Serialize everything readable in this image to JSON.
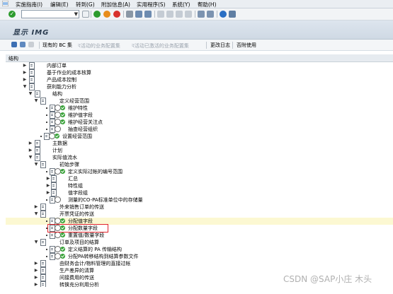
{
  "menu": {
    "items": [
      "实施指南(I)",
      "编辑(E)",
      "转到(G)",
      "附加信息(A)",
      "实用程序(S)",
      "系统(Y)",
      "帮助(H)"
    ]
  },
  "page": {
    "title": "显示 IMG"
  },
  "app_toolbar": {
    "bc_sets_label": "现有的 BC 集",
    "active_bc_label": "ব活动的业务配置集",
    "active_bc_label2": "ব活动已激活的业务配置集",
    "change_log_label": "更改日志",
    "release_notes_label": "否附使用"
  },
  "tree": {
    "header": "结构",
    "rows": [
      {
        "label": "内部订单"
      },
      {
        "label": "基于作业的成本核算"
      },
      {
        "label": "产品成本控制"
      },
      {
        "label": "获利能力分析"
      },
      {
        "label": "结构"
      },
      {
        "label": "定义经营范围"
      },
      {
        "label": "维护特性"
      },
      {
        "label": "维护值字段"
      },
      {
        "label": "维护经营关注点"
      },
      {
        "label": "抽查经营组织"
      },
      {
        "label": "设置经营范围"
      },
      {
        "label": "主数据"
      },
      {
        "label": "计划"
      },
      {
        "label": "实际值流水"
      },
      {
        "label": "初始步骤"
      },
      {
        "label": "定义实际过帐的编号范围"
      },
      {
        "label": "汇总"
      },
      {
        "label": "特性组"
      },
      {
        "label": "值字段组"
      },
      {
        "label": "测量的CO-PA标准单位中的存储量"
      },
      {
        "label": "外来销售订单的传送"
      },
      {
        "label": "开票凭证的传送"
      },
      {
        "label": "分配值字段"
      },
      {
        "label": "分配数量字段"
      },
      {
        "label": "重置值/数量字段"
      },
      {
        "label": "订单及项目的结算"
      },
      {
        "label": "定义结算的 PA 传输结构"
      },
      {
        "label": "分配PA转移结构到结算参数文件"
      },
      {
        "label": "由财务会计/物料管理的直接过帐"
      },
      {
        "label": "生产差异的清算"
      },
      {
        "label": "间接费用的传送"
      },
      {
        "label": "转换充分利用分析"
      }
    ]
  },
  "watermark": "CSDN @SAP小庄 木头"
}
